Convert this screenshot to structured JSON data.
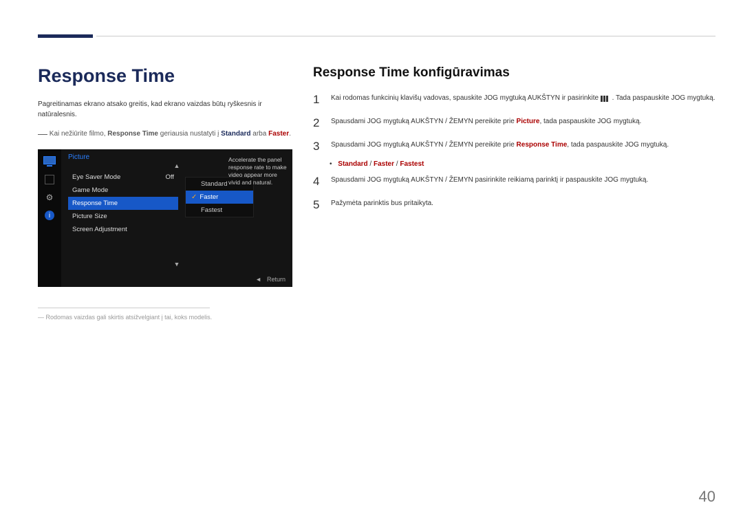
{
  "title": "Response Time",
  "intro": "Pagreitinamas ekrano atsako greitis, kad ekrano vaizdas būtų ryškesnis ir natūralesnis.",
  "note": {
    "prefix": "Kai nežiūrite filmo, ",
    "bold": "Response Time",
    "mid": " geriausia nustatyti į ",
    "opt1": "Standard",
    "mid2": " arba ",
    "opt2": "Faster",
    "suffix": "."
  },
  "osd": {
    "sidebar_icons": [
      "monitor",
      "square",
      "gear",
      "info"
    ],
    "title": "Picture",
    "items": [
      {
        "label": "Eye Saver Mode",
        "value": "Off"
      },
      {
        "label": "Game Mode",
        "value": ""
      },
      {
        "label": "Response Time",
        "value": ""
      },
      {
        "label": "Picture Size",
        "value": ""
      },
      {
        "label": "Screen Adjustment",
        "value": ""
      }
    ],
    "selected_index": 2,
    "submenu": [
      "Standard",
      "Faster",
      "Fastest"
    ],
    "submenu_selected": 1,
    "description": "Accelerate the panel response rate to make video appear more vivid and natural.",
    "footer_nav": "◄",
    "footer_label": "Return"
  },
  "footnote": "― Rodomas vaizdas gali skirtis atsižvelgiant į tai, koks modelis.",
  "h2": "Response Time konfigūravimas",
  "steps": [
    {
      "num": "1",
      "pre": "Kai rodomas funkcinių klavišų vadovas, spauskite JOG mygtuką AUKŠTYN ir pasirinkite ",
      "icon": true,
      "post": ". Tada paspauskite JOG mygtuką."
    },
    {
      "num": "2",
      "pre": "Spausdami JOG mygtuką AUKŠTYN / ŽEMYN pereikite prie ",
      "red": "Picture",
      "post": ", tada paspauskite JOG mygtuką."
    },
    {
      "num": "3",
      "pre": "Spausdami JOG mygtuką AUKŠTYN / ŽEMYN pereikite prie ",
      "red": "Response Time",
      "post": ", tada paspauskite JOG mygtuką."
    },
    {
      "num": "4",
      "pre": "Spausdami JOG mygtuką AUKŠTYN / ŽEMYN pasirinkite reikiamą parinktį ir paspauskite JOG mygtuką."
    },
    {
      "num": "5",
      "pre": "Pažymėta parinktis bus pritaikyta."
    }
  ],
  "options_bullet": {
    "prefix": "•",
    "o1": "Standard",
    "o2": "Faster",
    "o3": "Fastest"
  },
  "page_number": "40"
}
